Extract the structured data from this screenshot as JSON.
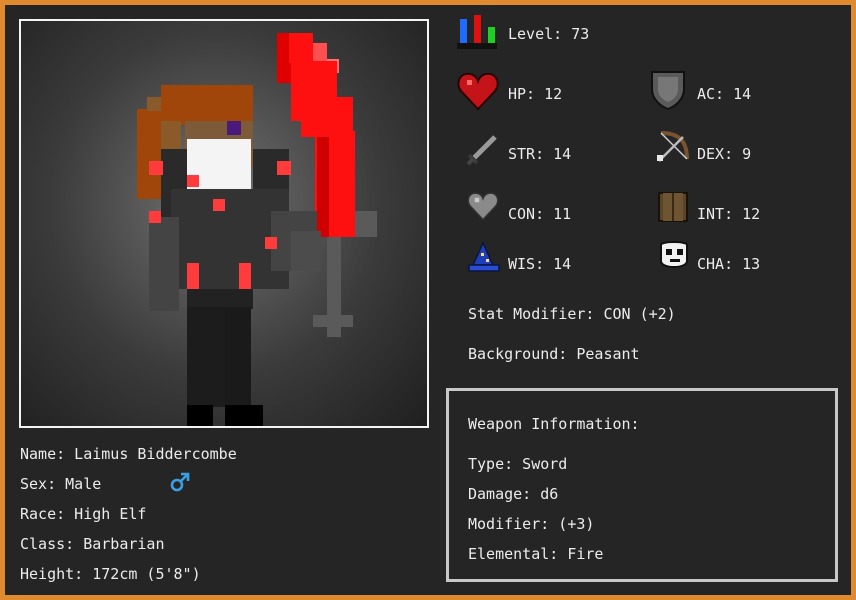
{
  "character": {
    "name_line": "Name: Laimus Biddercombe",
    "sex_line": "Sex: Male",
    "race_line": "Race: High Elf",
    "class_line": "Class: Barbarian",
    "height_line": "Height: 172cm (5'8\")"
  },
  "stats": {
    "level": "Level: 73",
    "hp": "HP: 12",
    "ac": "AC: 14",
    "str": "STR: 14",
    "dex": "DEX: 9",
    "con": "CON: 11",
    "int": "INT: 12",
    "wis": "WIS: 14",
    "cha": "CHA: 13",
    "stat_modifier": "Stat Modifier: CON (+2)",
    "background": "Background: Peasant"
  },
  "weapon": {
    "heading": "Weapon Information:",
    "type": "Type: Sword",
    "damage": "Damage: d6",
    "modifier": "Modifier: (+3)",
    "elemental": "Elemental: Fire"
  },
  "icons": {
    "level": "level-bars-icon",
    "hp": "heart-icon",
    "ac": "shield-icon",
    "str": "sword-icon",
    "dex": "bow-icon",
    "con": "grey-heart-icon",
    "int": "book-icon",
    "wis": "wizard-hat-icon",
    "cha": "skull-mask-icon",
    "sex": "male-symbol-icon"
  },
  "colors": {
    "frame_border": "#e08a30",
    "panel_bg": "#252525",
    "text": "#ececec",
    "sex_symbol": "#3aa0e6",
    "weapon_glow": "#ff1010"
  }
}
